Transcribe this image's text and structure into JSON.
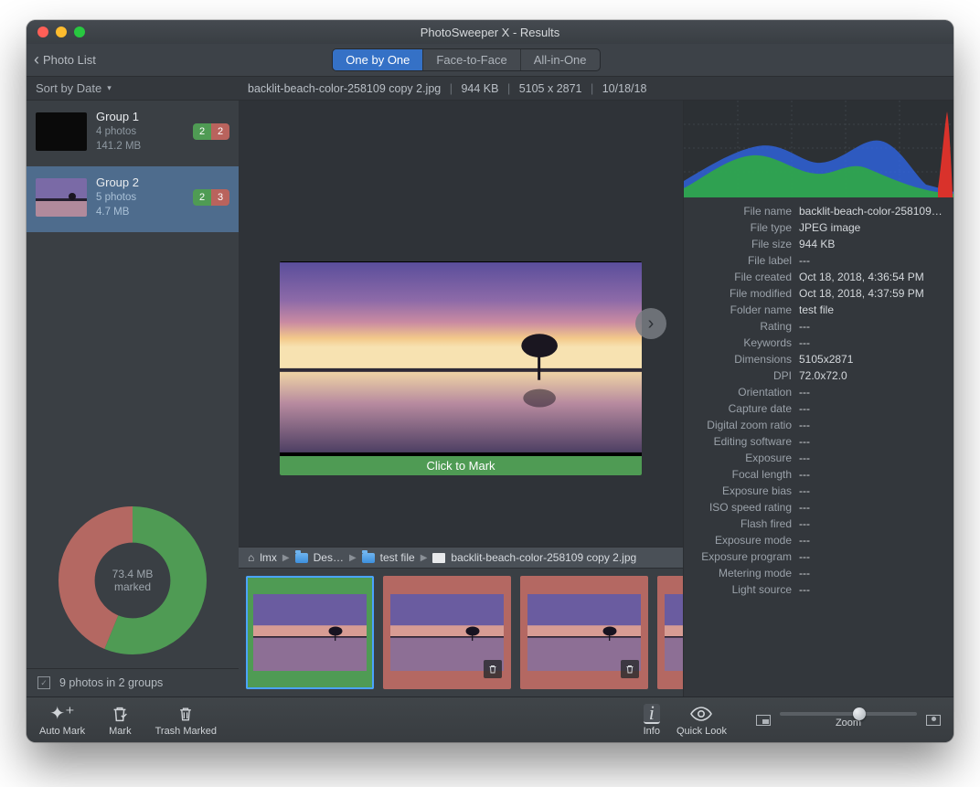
{
  "window": {
    "title": "PhotoSweeper X - Results"
  },
  "toolbar": {
    "back_label": "Photo List",
    "seg": {
      "one": "One by One",
      "face": "Face-to-Face",
      "all": "All-in-One"
    }
  },
  "sort": {
    "label": "Sort by Date"
  },
  "file_header": {
    "name": "backlit-beach-color-258109 copy 2.jpg",
    "size": "944 KB",
    "dims": "5105 x 2871",
    "date": "10/18/18"
  },
  "groups": [
    {
      "name": "Group 1",
      "count": "4 photos",
      "size": "141.2 MB",
      "green": "2",
      "red": "2",
      "selected": false,
      "black_thumb": true
    },
    {
      "name": "Group 2",
      "count": "5 photos",
      "size": "4.7 MB",
      "green": "2",
      "red": "3",
      "selected": true,
      "black_thumb": false
    }
  ],
  "donut": {
    "line1": "73.4 MB",
    "line2": "marked"
  },
  "sidebar_status": "9 photos in 2 groups",
  "preview": {
    "mark_label": "Click to Mark"
  },
  "breadcrumb": {
    "p0": "lmx",
    "p1": "Des…",
    "p2": "test file",
    "p3": "backlit-beach-color-258109 copy 2.jpg"
  },
  "filmstrip": [
    {
      "color": "green",
      "selected": true,
      "trash": false
    },
    {
      "color": "red",
      "selected": false,
      "trash": true
    },
    {
      "color": "red",
      "selected": false,
      "trash": true
    },
    {
      "color": "red",
      "selected": false,
      "trash": true
    },
    {
      "color": "green",
      "selected": false,
      "trash": false
    }
  ],
  "meta": [
    {
      "k": "File name",
      "v": "backlit-beach-color-258109…"
    },
    {
      "k": "File type",
      "v": "JPEG image"
    },
    {
      "k": "File size",
      "v": "944 KB"
    },
    {
      "k": "File label",
      "v": "---"
    },
    {
      "k": "File created",
      "v": "Oct 18, 2018, 4:36:54 PM"
    },
    {
      "k": "File modified",
      "v": "Oct 18, 2018, 4:37:59 PM"
    },
    {
      "k": "Folder name",
      "v": "test file"
    },
    {
      "k": "Rating",
      "v": "---"
    },
    {
      "k": "Keywords",
      "v": "---"
    },
    {
      "k": "Dimensions",
      "v": "5105x2871"
    },
    {
      "k": "DPI",
      "v": "72.0x72.0"
    },
    {
      "k": "Orientation",
      "v": "---"
    },
    {
      "k": "Capture date",
      "v": "---"
    },
    {
      "k": "Digital zoom ratio",
      "v": "---"
    },
    {
      "k": "Editing software",
      "v": "---"
    },
    {
      "k": "Exposure",
      "v": "---"
    },
    {
      "k": "Focal length",
      "v": "---"
    },
    {
      "k": "Exposure bias",
      "v": "---"
    },
    {
      "k": "ISO speed rating",
      "v": "---"
    },
    {
      "k": "Flash fired",
      "v": "---"
    },
    {
      "k": "Exposure mode",
      "v": "---"
    },
    {
      "k": "Exposure program",
      "v": "---"
    },
    {
      "k": "Metering mode",
      "v": "---"
    },
    {
      "k": "Light source",
      "v": "---"
    }
  ],
  "bottom": {
    "auto_mark": "Auto Mark",
    "mark": "Mark",
    "trash_marked": "Trash Marked",
    "info": "Info",
    "quick_look": "Quick Look",
    "zoom": "Zoom"
  },
  "chart_data": {
    "type": "histogram-rgb",
    "note": "Color histogram of selected image; heavy greens/blues in low-mid tones, narrow red spike at high end.",
    "x_range": [
      0,
      255
    ]
  }
}
